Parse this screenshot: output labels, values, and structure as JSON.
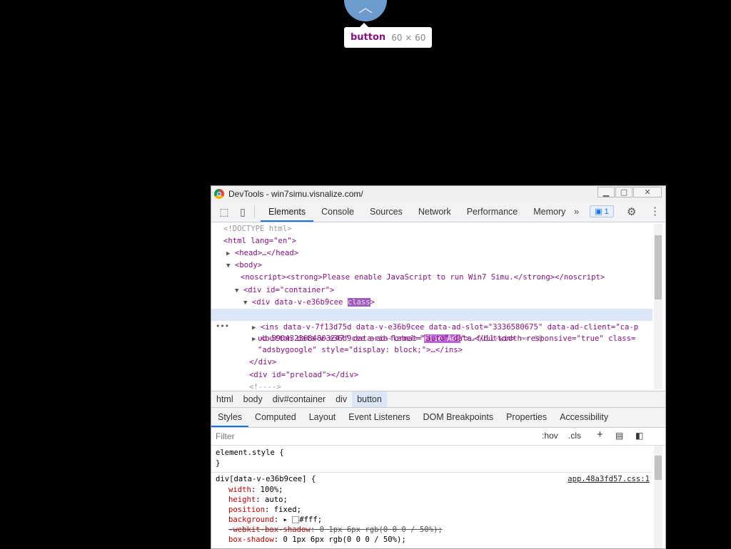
{
  "tooltip": {
    "tag": "button",
    "size": "60 × 60"
  },
  "window": {
    "title": "DevTools - win7simu.visnalize.com/"
  },
  "tabs": [
    "Elements",
    "Console",
    "Sources",
    "Network",
    "Performance",
    "Memory"
  ],
  "issues_badge": "1",
  "dom": {
    "doctype": "<!DOCTYPE html>",
    "html_open": "<html lang=\"en\">",
    "head": "<head>…</head>",
    "body": "<body>",
    "noscript": "<noscript><strong>Please enable JavaScript to run Win7 Simu.</strong></noscript>",
    "container": "<div id=\"container\">",
    "div_open": "<div data-v-e36b9cee ",
    "div_class": "class",
    "button_pre": "<button data-v-e36b9cee aria-label=\"",
    "button_hl": "Hide Ads",
    "button_post": "\">…</button>",
    "button_eq": " == $0",
    "ins_line1": "<ins data-v-7f13d75d data-v-e36b9cee data-ad-slot=\"3336580675\" data-ad-client=\"ca-p",
    "ins_line2": "ub-5904323684803247\" data-ad-format=\"auto\" data-full-width-responsive=\"true\" class=",
    "ins_line3": "\"adsbygoogle\" style=\"display: block;\">…</ins>",
    "div_close": "</div>",
    "preload": "<div id=\"preload\"></div>",
    "comment": "<!---->"
  },
  "breadcrumbs": [
    "html",
    "body",
    "div#container",
    "div",
    "button"
  ],
  "style_tabs": [
    "Styles",
    "Computed",
    "Layout",
    "Event Listeners",
    "DOM Breakpoints",
    "Properties",
    "Accessibility"
  ],
  "filter": {
    "placeholder": "Filter",
    "hov": ":hov",
    "cls": ".cls"
  },
  "styles": {
    "element_style": "element.style {",
    "close_brace": "}",
    "selector": "div[data-v-e36b9cee] {",
    "source": "app.48a3fd57.css:1",
    "props": [
      {
        "name": "width",
        "value": "100%;"
      },
      {
        "name": "height",
        "value": "auto;"
      },
      {
        "name": "position",
        "value": "fixed;"
      },
      {
        "name": "background",
        "value": "#fff;"
      }
    ],
    "webkit_shadow_name": "-webkit-box-shadow",
    "webkit_shadow_value": "0 1px 6px rgb(0 0 0 / 50%);",
    "shadow_name": "box-shadow",
    "shadow_value": "0 1px 6px rgb(0 0 0 / 50%);"
  }
}
